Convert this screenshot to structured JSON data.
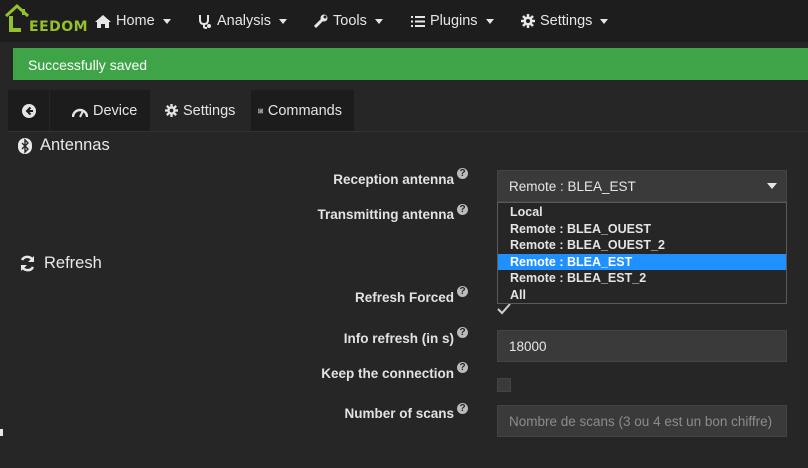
{
  "navbar": {
    "logo_text": "EEDOM",
    "items": [
      {
        "label": "Home",
        "icon": "home-icon"
      },
      {
        "label": "Analysis",
        "icon": "stethoscope-icon"
      },
      {
        "label": "Tools",
        "icon": "wrench-icon"
      },
      {
        "label": "Plugins",
        "icon": "list-icon"
      },
      {
        "label": "Settings",
        "icon": "gear-icon"
      }
    ]
  },
  "alert": {
    "text": "Successfully saved",
    "color": "#3ea447"
  },
  "tabs": [
    {
      "label": "Device",
      "icon": "tachometer-icon"
    },
    {
      "label": "Settings",
      "icon": "gear-icon",
      "active": true
    },
    {
      "label": "Commands",
      "icon": "list-alt-icon"
    }
  ],
  "sections": {
    "antennas": {
      "title": "Antennas",
      "icon": "bluetooth-icon"
    },
    "refresh": {
      "title": "Refresh",
      "icon": "refresh-icon"
    }
  },
  "fields": {
    "reception_antenna": {
      "label": "Reception antenna",
      "value": "Remote : BLEA_EST"
    },
    "transmitting_antenna": {
      "label": "Transmitting antenna",
      "options": [
        "Local",
        "Remote : BLEA_OUEST",
        "Remote : BLEA_OUEST_2",
        "Remote : BLEA_EST",
        "Remote : BLEA_EST_2",
        "All"
      ],
      "selected": "Remote : BLEA_EST"
    },
    "refresh_forced": {
      "label": "Refresh Forced",
      "checked": true
    },
    "info_refresh": {
      "label": "Info refresh (in s)",
      "value": "18000"
    },
    "keep_connection": {
      "label": "Keep the connection",
      "checked": false
    },
    "number_of_scans": {
      "label": "Number of scans",
      "placeholder": "Nombre de scans (3 ou 4 est un bon chiffre)"
    }
  },
  "help_symbol": "?",
  "colors": {
    "accent": "#94c12b",
    "selected_option": "#1e90ff"
  }
}
